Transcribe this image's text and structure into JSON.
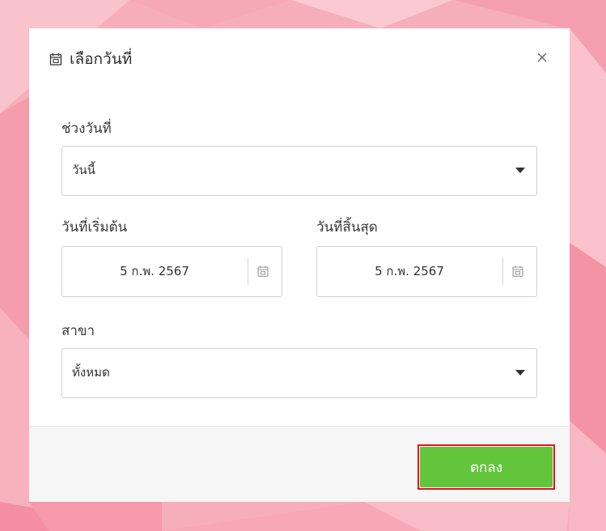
{
  "dialog": {
    "title": "เลือกวันที่"
  },
  "range": {
    "label": "ช่วงวันที่",
    "value": "วันนี้"
  },
  "start_date": {
    "label": "วันที่เริ่มต้น",
    "value": "5 ก.พ. 2567"
  },
  "end_date": {
    "label": "วันที่สิ้นสุด",
    "value": "5 ก.พ. 2567"
  },
  "branch": {
    "label": "สาขา",
    "value": "ทั้งหมด"
  },
  "footer": {
    "ok_label": "ตกลง"
  },
  "icons": {
    "header": "calendar-icon",
    "close": "close-icon",
    "date_picker": "calendar-icon",
    "dropdown": "caret-down-icon"
  },
  "colors": {
    "background": "#f7aebb",
    "ok_button": "#62c53c",
    "highlight_border": "#e1151c"
  }
}
